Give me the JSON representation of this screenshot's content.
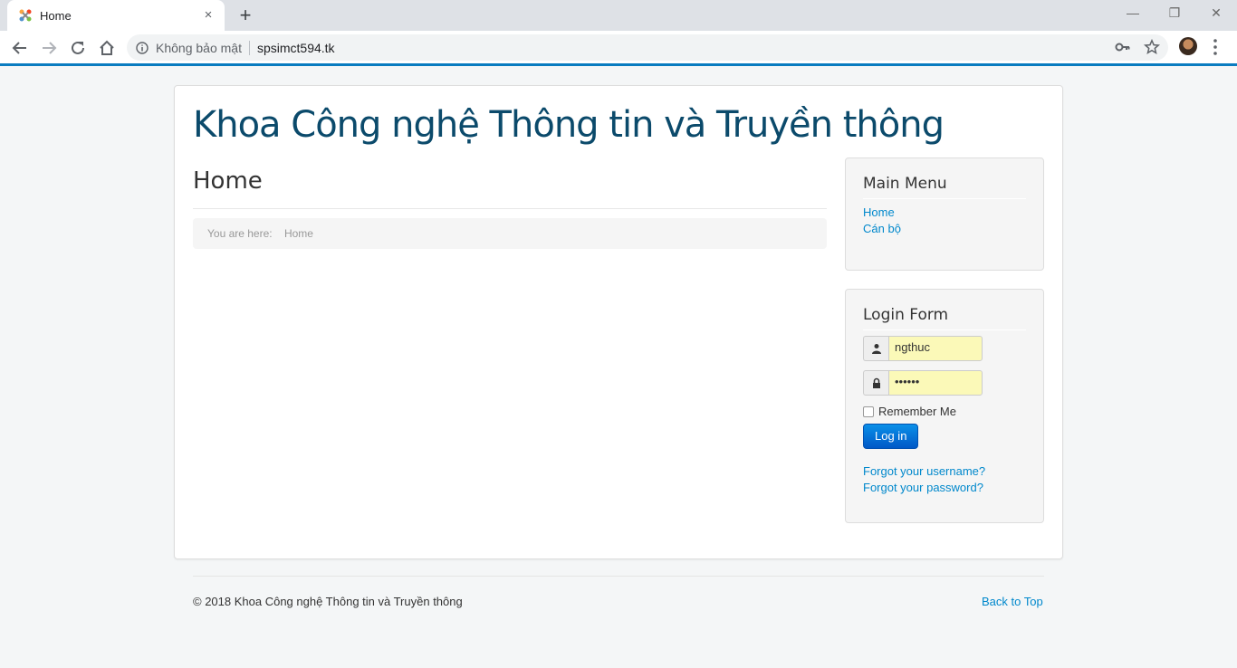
{
  "browser": {
    "tab_title": "Home",
    "tab_close": "×",
    "new_tab": "+",
    "security_label": "Không bảo mật",
    "url": "spsimct594.tk",
    "window_controls": {
      "minimize": "—",
      "restore": "❐",
      "close": "✕"
    }
  },
  "site": {
    "title": "Khoa Công nghệ Thông tin và Truyền thông"
  },
  "main": {
    "heading": "Home",
    "breadcrumb": {
      "label": "You are here:",
      "items": [
        "Home"
      ]
    }
  },
  "main_menu": {
    "title": "Main Menu",
    "items": [
      "Home",
      "Cán bộ"
    ]
  },
  "login_form": {
    "title": "Login Form",
    "username": "ngthuc",
    "password": "••••••",
    "remember_label": "Remember Me",
    "login_button": "Log in",
    "forgot_username": "Forgot your username?",
    "forgot_password": "Forgot your password?"
  },
  "footer": {
    "copyright": "© 2018 Khoa Công nghệ Thông tin và Truyền thông",
    "back_to_top": "Back to Top"
  },
  "colors": {
    "accent": "#0a7cc0",
    "title": "#0b4a6b",
    "link": "#0088cc",
    "autofill": "#fbf9b8"
  }
}
